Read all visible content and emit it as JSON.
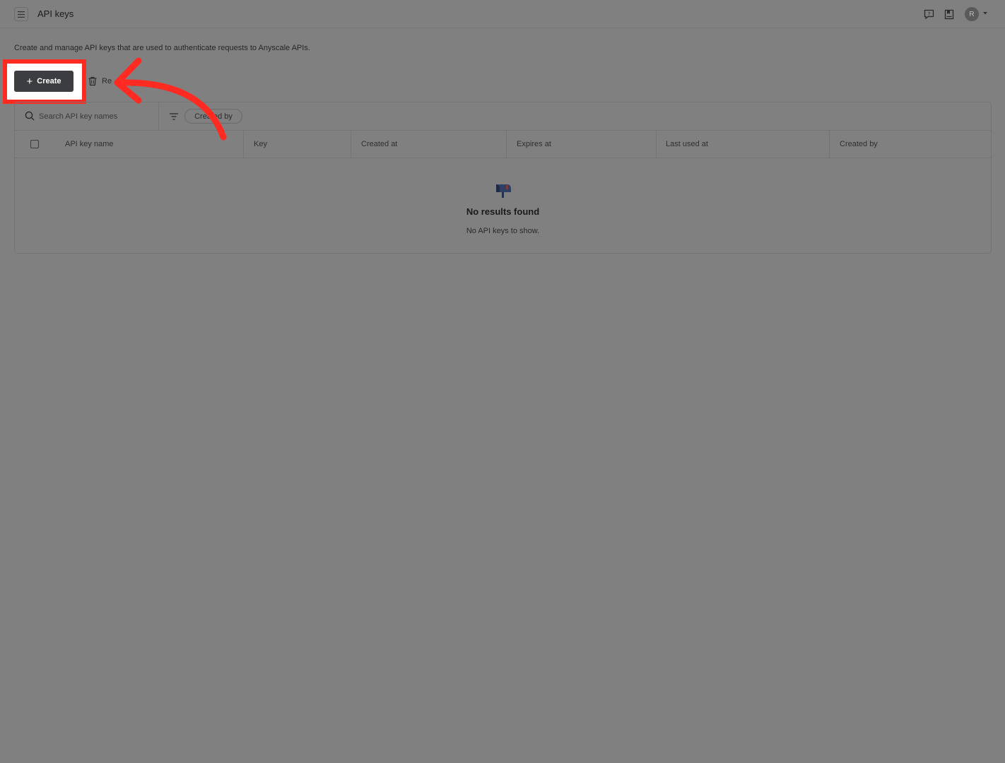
{
  "header": {
    "title": "API keys",
    "avatar_initial": "R"
  },
  "page": {
    "description": "Create and manage API keys that are used to authenticate requests to Anyscale APIs."
  },
  "toolbar": {
    "create_label": "Create",
    "revoke_label_visible": "Re"
  },
  "filters": {
    "search_placeholder": "Search API key names",
    "created_by_label": "Created by"
  },
  "table": {
    "columns": [
      "API key name",
      "Key",
      "Created at",
      "Expires at",
      "Last used at",
      "Created by"
    ]
  },
  "empty_state": {
    "title": "No results found",
    "subtitle": "No API keys to show."
  },
  "colors": {
    "overlay": "#808080",
    "highlight": "#ff2b22",
    "primary_button": "#3b3d40"
  },
  "icons": [
    "menu-icon",
    "feedback-icon",
    "docs-icon",
    "chevron-down-icon",
    "trash-icon",
    "search-icon",
    "filter-icon",
    "mailbox-icon"
  ]
}
